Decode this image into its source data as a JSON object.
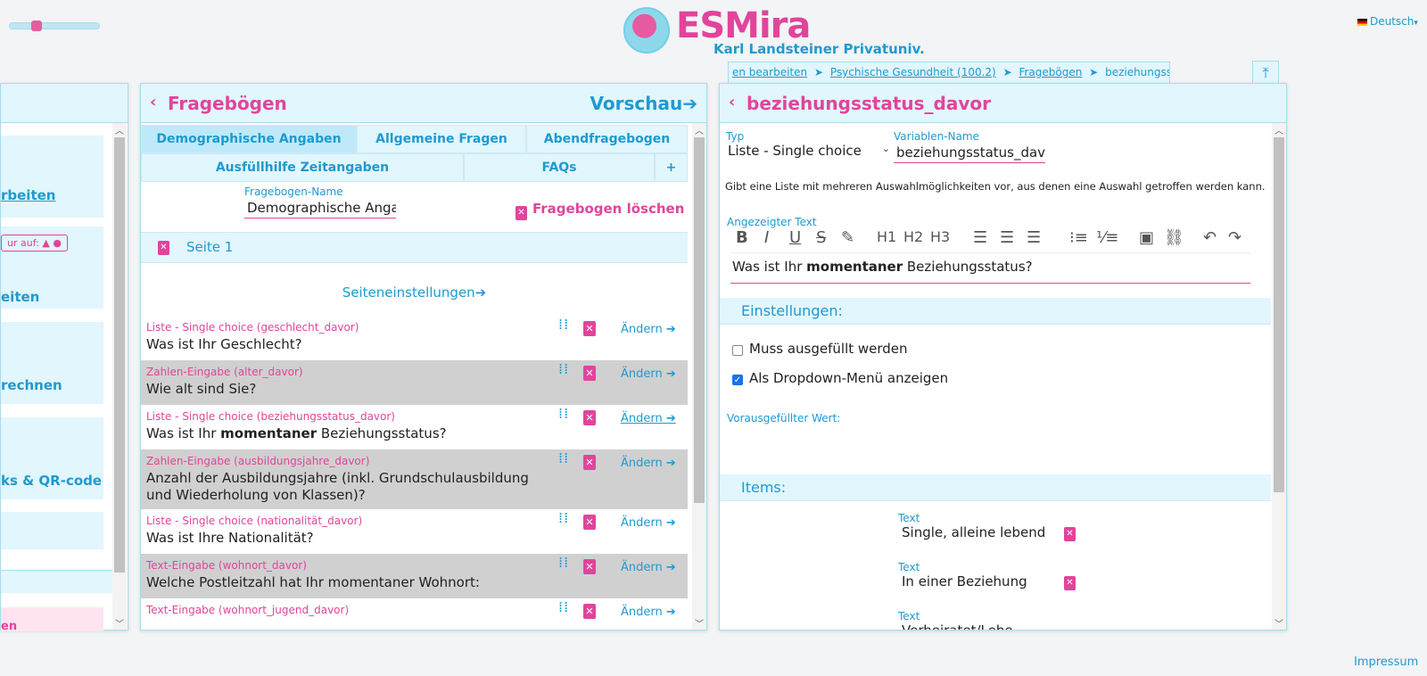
{
  "header": {
    "logo_text": "ESMira",
    "subtitle": "Karl Landsteiner Privatuniv.",
    "language": "Deutsch",
    "language_caret": "▾"
  },
  "breadcrumb": {
    "items": [
      "en bearbeiten",
      "Psychische Gesundheit (100.2)",
      "Fragebögen",
      "beziehungsstatus_davor"
    ],
    "separator": "➤"
  },
  "left_panel": {
    "items": [
      "rbeiten",
      "ur auf:",
      "eiten",
      "rechnen",
      "ks & QR-code",
      "en"
    ]
  },
  "middle_panel": {
    "back": "‹",
    "title": "Fragebögen",
    "preview": "Vorschau➔",
    "tabs_row1": [
      "Demographische Angaben",
      "Allgemeine Fragen",
      "Abendfragebogen"
    ],
    "tabs_row2": [
      "Ausfüllhilfe Zeitangaben",
      "FAQs",
      "+"
    ],
    "name_label": "Fragebogen-Name",
    "name_value": "Demographische Angab",
    "delete_label": "Fragebogen löschen",
    "page_label": "Seite 1",
    "page_settings": "Seiteneinstellungen➔",
    "edit_label": "Ändern",
    "questions": [
      {
        "type": "Liste - Single choice (geschlecht_davor)",
        "text": "Was ist Ihr Geschlecht?"
      },
      {
        "type": "Zahlen-Eingabe (alter_davor)",
        "text": "Wie alt sind Sie?"
      },
      {
        "type": "Liste - Single choice (beziehungsstatus_davor)",
        "text_pre": "Was ist Ihr ",
        "text_bold": "momentaner",
        "text_post": " Beziehungsstatus?"
      },
      {
        "type": "Zahlen-Eingabe (ausbildungsjahre_davor)",
        "text": "Anzahl der Ausbildungsjahre (inkl. Grundschulausbildung und Wiederholung von Klassen)?"
      },
      {
        "type": "Liste - Single choice (nationalität_davor)",
        "text": "Was ist Ihre Nationalität?"
      },
      {
        "type": "Text-Eingabe (wohnort_davor)",
        "text": "Welche Postleitzahl hat Ihr momentaner Wohnort:"
      },
      {
        "type": "Text-Eingabe (wohnort_jugend_davor)",
        "text": ""
      }
    ]
  },
  "right_panel": {
    "back": "‹",
    "title": "beziehungsstatus_davor",
    "type_label": "Typ",
    "type_value": "Liste - Single choice",
    "var_label": "Variablen-Name",
    "var_value": "beziehungsstatus_davo",
    "description": "Gibt eine Liste mit mehreren Auswahlmöglichkeiten vor, aus denen eine Auswahl getroffen werden kann.",
    "shown_text_label": "Angezeigter Text",
    "shown_text_pre": "Was ist Ihr ",
    "shown_text_bold": "momentaner",
    "shown_text_post": " Beziehungsstatus?",
    "settings_header": "Einstellungen:",
    "required_label": "Muss ausgefüllt werden",
    "required_checked": false,
    "dropdown_label": "Als Dropdown-Menü anzeigen",
    "dropdown_checked": true,
    "prefilled_label": "Vorausgefüllter Wert:",
    "items_header": "Items:",
    "item_label": "Text",
    "items": [
      "Single, alleine lebend",
      "In einer Beziehung",
      "Verheiratet/Lebe"
    ]
  },
  "footer": {
    "impressum": "Impressum"
  },
  "colors": {
    "accent_blue": "#1e9ad0",
    "accent_pink": "#e2449b",
    "panel_header": "#e1f6fd"
  }
}
